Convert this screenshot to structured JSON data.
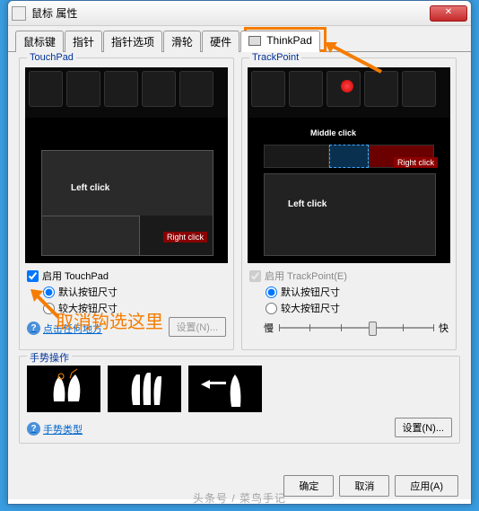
{
  "window": {
    "title": "鼠标 属性"
  },
  "tabs": {
    "items": [
      "鼠标键",
      "指针",
      "指针选项",
      "滑轮",
      "硬件",
      "ThinkPad"
    ],
    "active_index": 5
  },
  "touchpad_group": {
    "title": "TouchPad",
    "left_click_label": "Left click",
    "right_click_label": "Right click",
    "enable_label": "启用 TouchPad",
    "radio_default": "默认按钮尺寸",
    "radio_large": "较大按钮尺寸",
    "help_link": "点击任何地方",
    "settings_btn": "设置(N)..."
  },
  "trackpoint_group": {
    "title": "TrackPoint",
    "middle_click_label": "Middle click",
    "right_click_label": "Right click",
    "left_click_label": "Left click",
    "enable_label": "启用 TrackPoint(E)",
    "radio_default": "默认按钮尺寸",
    "radio_large": "较大按钮尺寸",
    "slow_label": "慢",
    "fast_label": "快"
  },
  "gesture_group": {
    "title": "手势操作",
    "settings_btn": "设置(N)...",
    "help_link": "手势类型"
  },
  "dialog_buttons": {
    "ok": "确定",
    "cancel": "取消",
    "apply": "应用(A)"
  },
  "annotations": {
    "uncheck_here": "取消钩选这里"
  },
  "watermark": "头条号 / 菜鸟手记"
}
